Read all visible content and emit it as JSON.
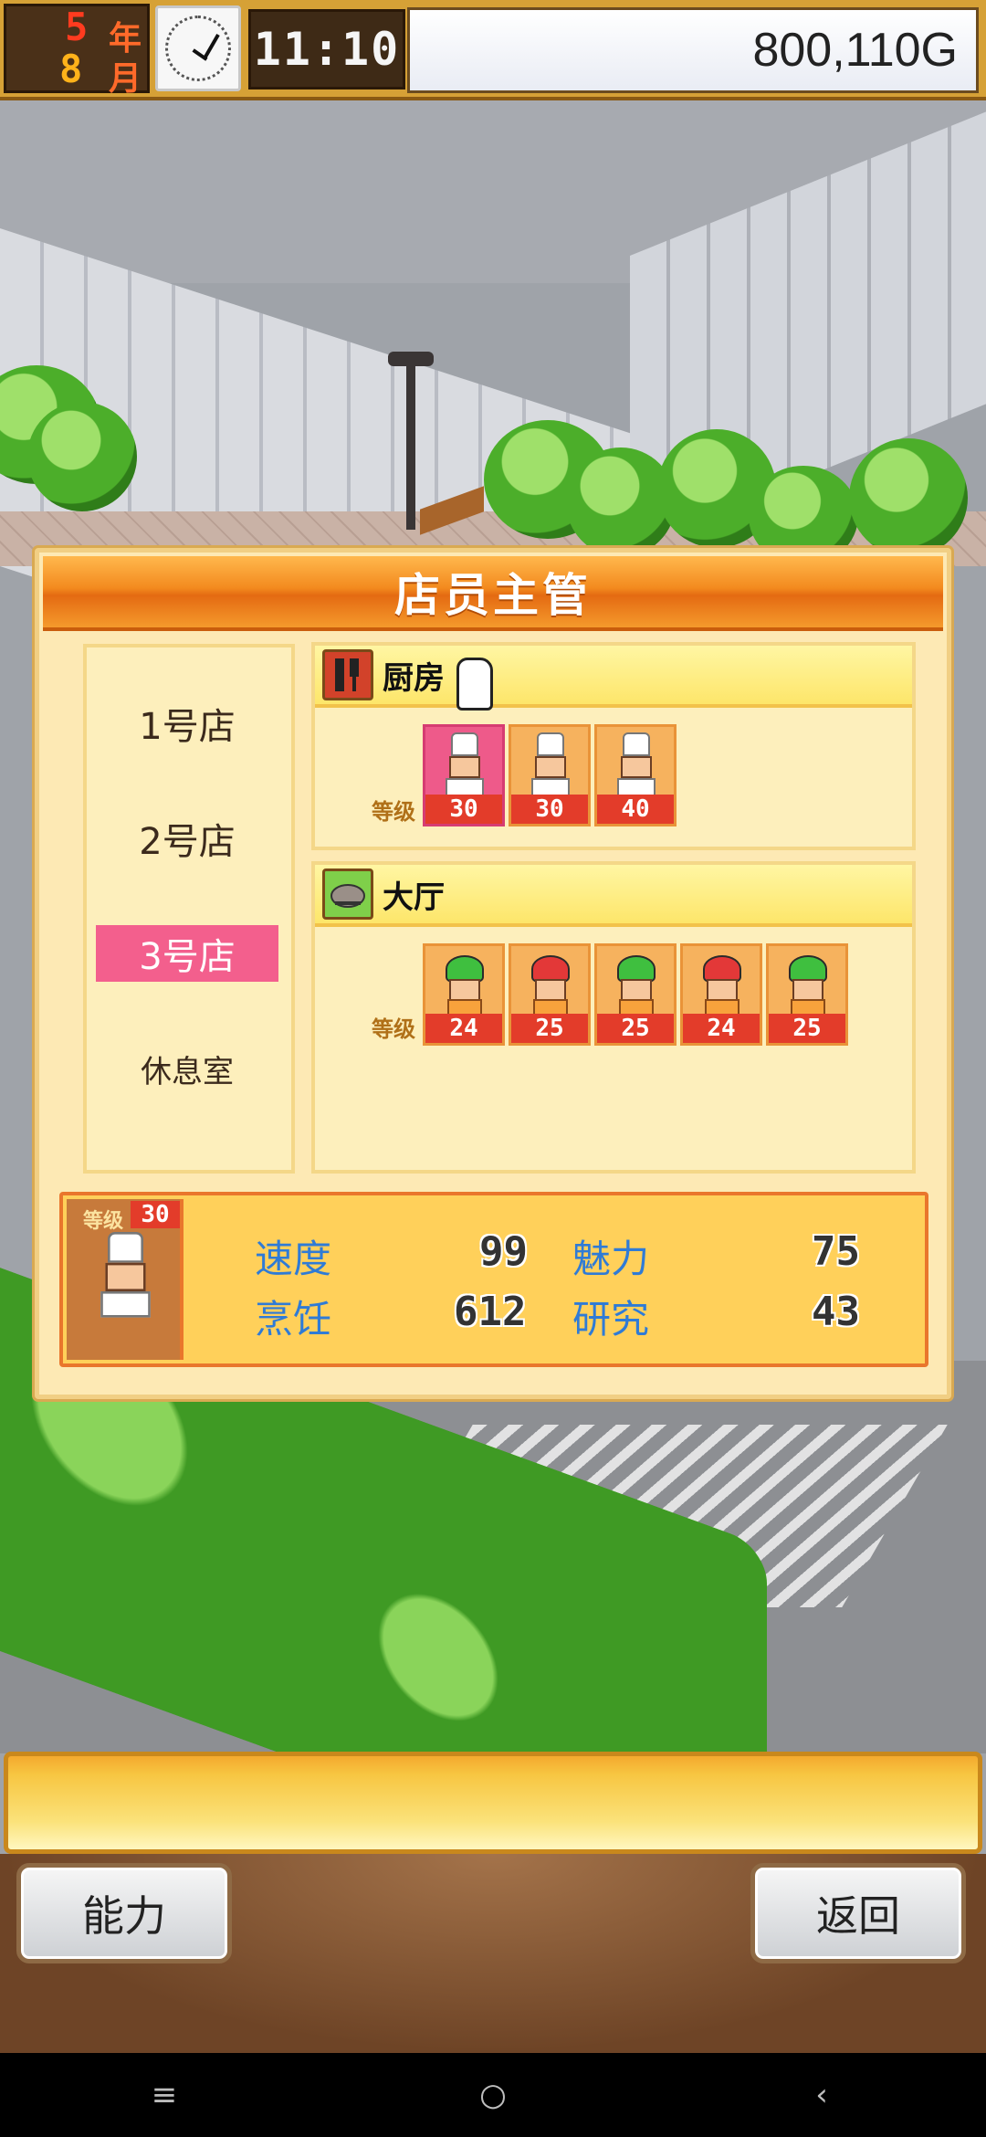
{
  "hud": {
    "year_value": "5",
    "year_unit": "年",
    "month_value": "8",
    "month_unit": "月",
    "time": "11:10",
    "money": "800,110G"
  },
  "dialog": {
    "title": "店员主管",
    "stores": [
      {
        "label": "1号店",
        "active": false
      },
      {
        "label": "2号店",
        "active": false
      },
      {
        "label": "3号店",
        "active": true
      },
      {
        "label": "休息室",
        "active": false
      }
    ],
    "kitchen": {
      "title": "厨房",
      "level_label": "等级",
      "staff": [
        {
          "level": "30",
          "type": "chef-female",
          "selected": true
        },
        {
          "level": "30",
          "type": "chef-male",
          "selected": false
        },
        {
          "level": "40",
          "type": "chef-female",
          "selected": false
        }
      ]
    },
    "hall": {
      "title": "大厅",
      "level_label": "等级",
      "staff": [
        {
          "level": "24",
          "hair": "green"
        },
        {
          "level": "25",
          "hair": "red"
        },
        {
          "level": "25",
          "hair": "green"
        },
        {
          "level": "24",
          "hair": "red"
        },
        {
          "level": "25",
          "hair": "green"
        }
      ]
    },
    "selected_employee": {
      "level_label": "等级",
      "level": "30",
      "stats": [
        {
          "label": "速度",
          "value": "99"
        },
        {
          "label": "魅力",
          "value": "75"
        },
        {
          "label": "烹饪",
          "value": "612"
        },
        {
          "label": "研究",
          "value": "43"
        }
      ]
    }
  },
  "buttons": {
    "ability": "能力",
    "back": "返回"
  },
  "navbar": {
    "menu": "≡",
    "home": "○",
    "back": "‹"
  },
  "colors": {
    "title_orange": "#f38a1e",
    "active_store": "#f35f8d",
    "level_badge": "#e33c2a",
    "stat_label": "#2f7bd6"
  }
}
